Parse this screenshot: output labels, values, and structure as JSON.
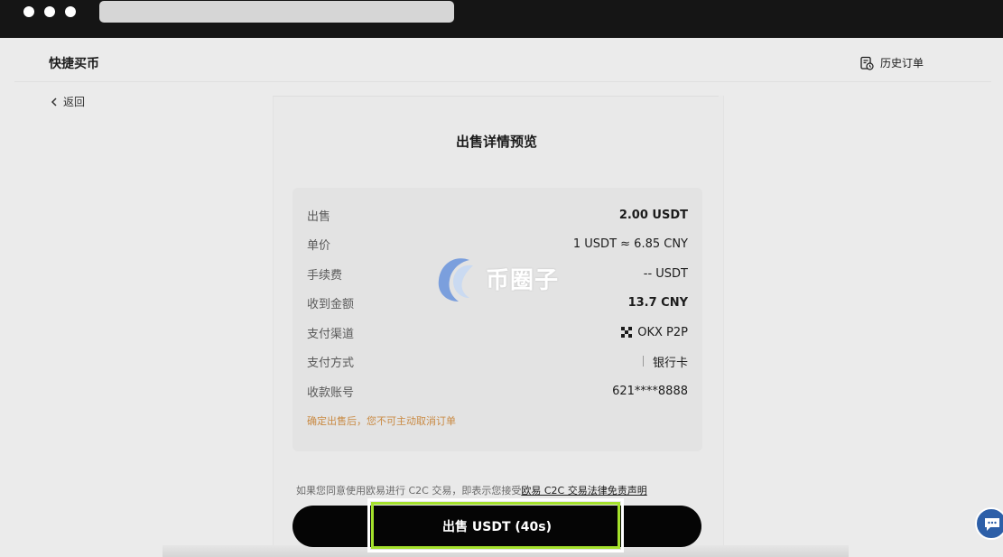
{
  "header": {
    "title": "快捷买币",
    "history_label": "历史订单",
    "back_label": "返回"
  },
  "preview": {
    "title": "出售详情预览",
    "rows": [
      {
        "label": "出售",
        "value": "2.00 USDT"
      },
      {
        "label": "单价",
        "value": "1 USDT ≈ 6.85 CNY"
      },
      {
        "label": "手续费",
        "value": "-- USDT"
      },
      {
        "label": "收到金额",
        "value": "13.7 CNY"
      },
      {
        "label": "支付渠道",
        "value": "OKX P2P"
      },
      {
        "label": "支付方式",
        "value": "银行卡"
      },
      {
        "label": "收款账号",
        "value": "621****8888"
      }
    ],
    "warning": "确定出售后，您不可主动取消订单"
  },
  "terms": {
    "text": "如果您同意使用欧易进行 C2C 交易，即表示您接受",
    "link": "欧易 C2C 交易法律免责声明"
  },
  "action": {
    "sell_label": "出售 USDT (40s)"
  },
  "watermark": {
    "text": "币圈子"
  },
  "icons": {
    "history": "history-order-icon",
    "back": "chevron-left-icon",
    "channel": "okx-logo-icon",
    "chat": "chat-bubble-icon"
  },
  "colors": {
    "warning": "#c98a43",
    "highlight": "#a4e12b",
    "button": "#050505",
    "chat": "#2d5fa8"
  }
}
